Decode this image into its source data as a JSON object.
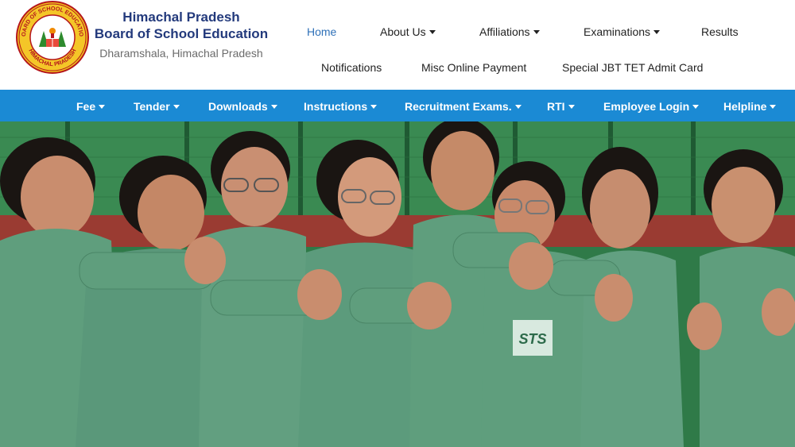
{
  "header": {
    "title_line1": "Himachal Pradesh",
    "title_line2": "Board of School Education",
    "subtitle": "Dharamshala, Himachal Pradesh",
    "logo_ring_text_top": "BOARD OF SCHOOL EDUCATION",
    "logo_ring_text_bottom": "HIMACHAL PRADESH"
  },
  "top_nav": [
    {
      "label": "Home"
    },
    {
      "label": "About Us"
    },
    {
      "label": "Affiliations"
    },
    {
      "label": "Examinations"
    },
    {
      "label": "Results"
    },
    {
      "label": "Notifications"
    },
    {
      "label": "Misc Online Payment"
    },
    {
      "label": "Special JBT TET Admit Card"
    }
  ],
  "blue_nav": [
    {
      "label": "Fee"
    },
    {
      "label": "Tender"
    },
    {
      "label": "Downloads"
    },
    {
      "label": "Instructions"
    },
    {
      "label": "Recruitment Exams."
    },
    {
      "label": "RTI"
    },
    {
      "label": "Employee Login"
    },
    {
      "label": "Helpline"
    }
  ],
  "colors": {
    "nav_bar": "#1b8ad4",
    "brand_text": "#233a7c",
    "active_link": "#2f71b8",
    "uniform_green": "#5f9e7d"
  },
  "photo": {
    "uniform_badge_text": "STS"
  }
}
